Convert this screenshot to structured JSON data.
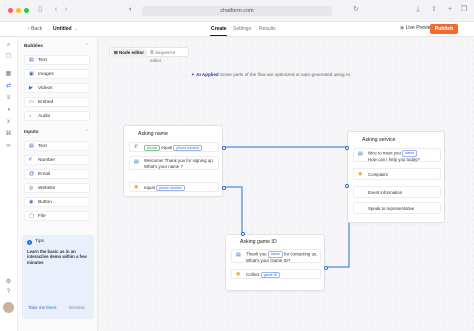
{
  "browser": {
    "url": "chatform.com"
  },
  "header": {
    "back_label": "Back",
    "project_name": "Untitled",
    "tabs": [
      {
        "label": "Create"
      },
      {
        "label": "Settings"
      },
      {
        "label": "Results"
      }
    ],
    "live_preview_label": "Live Preview",
    "publish_label": "Publish"
  },
  "sidebar": {
    "bubbles_title": "Bubbles",
    "bubbles": [
      {
        "label": "Text"
      },
      {
        "label": "Images"
      },
      {
        "label": "Videos"
      },
      {
        "label": "Embed"
      },
      {
        "label": "Audio"
      }
    ],
    "inputs_title": "Inputs",
    "inputs": [
      {
        "label": "Text"
      },
      {
        "label": "Number"
      },
      {
        "label": "Email"
      },
      {
        "label": "Website"
      },
      {
        "label": "Button"
      },
      {
        "label": "File"
      }
    ],
    "tips": {
      "title": "Tips",
      "text": "Learn the basic as in an interactive demo within a few minutes",
      "take_me_label": "Take me there",
      "dismiss_label": "Dismiss"
    }
  },
  "canvas": {
    "modes": [
      {
        "label": "Node editor"
      },
      {
        "label": "Sequence editor"
      }
    ],
    "ai_notice": {
      "label": "AI Applied",
      "text": "Some parts of the flow are optimized or auto-generated using AI."
    },
    "nodes": {
      "asking_name": {
        "title": "Asking name",
        "input_row": {
          "tag": "phone",
          "op": "equal",
          "var": "phone number"
        },
        "message": {
          "text1": "Welcome! Thank you for signing up.",
          "text2": "What's your name ?"
        },
        "cond_row": {
          "op": "equal",
          "var": "phone number"
        }
      },
      "asking_service": {
        "title": "Asking service",
        "message": {
          "pre": "Nice to meet you",
          "var": "name",
          "text2": "How can I help you today?"
        },
        "options": [
          {
            "label": "Complaint"
          },
          {
            "label": "Event information"
          },
          {
            "label": "Speak to representative"
          }
        ]
      },
      "asking_game_id": {
        "title": "Asking game ID",
        "message": {
          "pre": "Thank you",
          "var": "name",
          "post": "for contacting us.",
          "text2": "What's your Game ID?"
        },
        "collect": {
          "label": "Collect",
          "var": "game ID"
        }
      }
    }
  },
  "colors": {
    "accent": "#2b6fd6",
    "publish": "#f26a2c"
  }
}
